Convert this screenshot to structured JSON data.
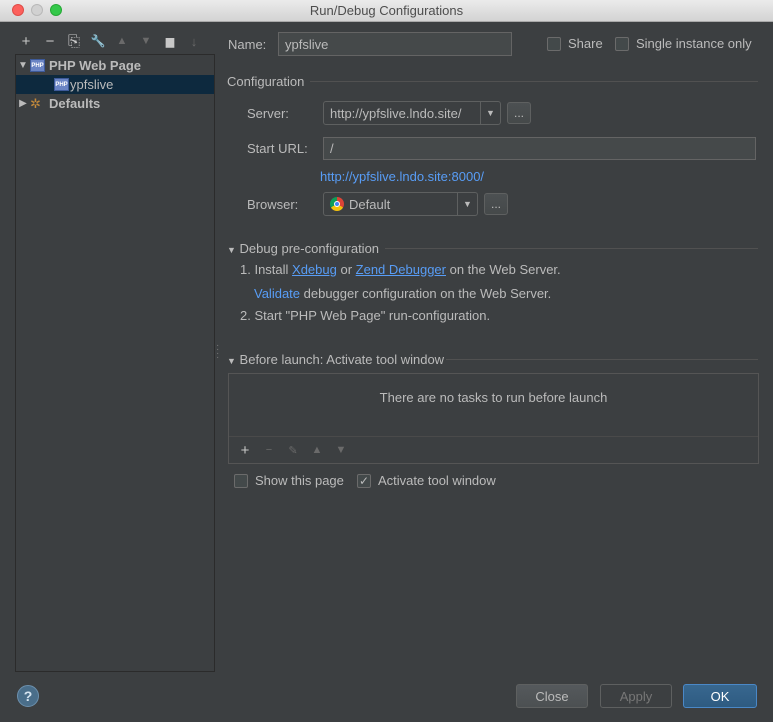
{
  "window": {
    "title": "Run/Debug Configurations"
  },
  "left_toolbar": {
    "add": "+",
    "remove": "−",
    "copy": "⎘",
    "edit_defaults": "🔧",
    "move_up": "▲",
    "move_down": "▼",
    "folder": "▆",
    "sort": "↓"
  },
  "tree": {
    "group": {
      "label": "PHP Web Page",
      "icon": "php-icon"
    },
    "child": {
      "label": "ypfslive",
      "icon": "php-icon"
    },
    "defaults": {
      "label": "Defaults",
      "icon": "wrench-icon"
    }
  },
  "header": {
    "name_label": "Name:",
    "name_value": "ypfslive",
    "share_label": "Share",
    "single_instance_label": "Single instance only"
  },
  "configuration": {
    "section_title": "Configuration",
    "server_label": "Server:",
    "server_value": "http://ypfslive.lndo.site/",
    "start_url_label": "Start URL:",
    "start_url_value": "/",
    "resolved_url": "http://ypfslive.lndo.site:8000/",
    "browser_label": "Browser:",
    "browser_value": "Default",
    "dots": "..."
  },
  "debug_preconfig": {
    "title": "Debug pre-configuration",
    "step1_prefix": "1. Install ",
    "xdebug": "Xdebug",
    "or": " or ",
    "zend": "Zend Debugger",
    "step1_suffix": " on the Web Server.",
    "validate": "Validate",
    "validate_suffix": " debugger configuration on the Web Server.",
    "step2": "2. Start \"PHP Web Page\" run-configuration."
  },
  "before_launch": {
    "title": "Before launch: Activate tool window",
    "empty_text": "There are no tasks to run before launch",
    "show_page_label": "Show this page",
    "activate_label": "Activate tool window",
    "show_page_checked": false,
    "activate_checked": true
  },
  "buttons": {
    "close": "Close",
    "apply": "Apply",
    "ok": "OK",
    "help": "?"
  },
  "colors": {
    "background": "#3c3f41",
    "link": "#589df6",
    "ok_button": "#2e5b81",
    "selection": "#0d293e"
  }
}
